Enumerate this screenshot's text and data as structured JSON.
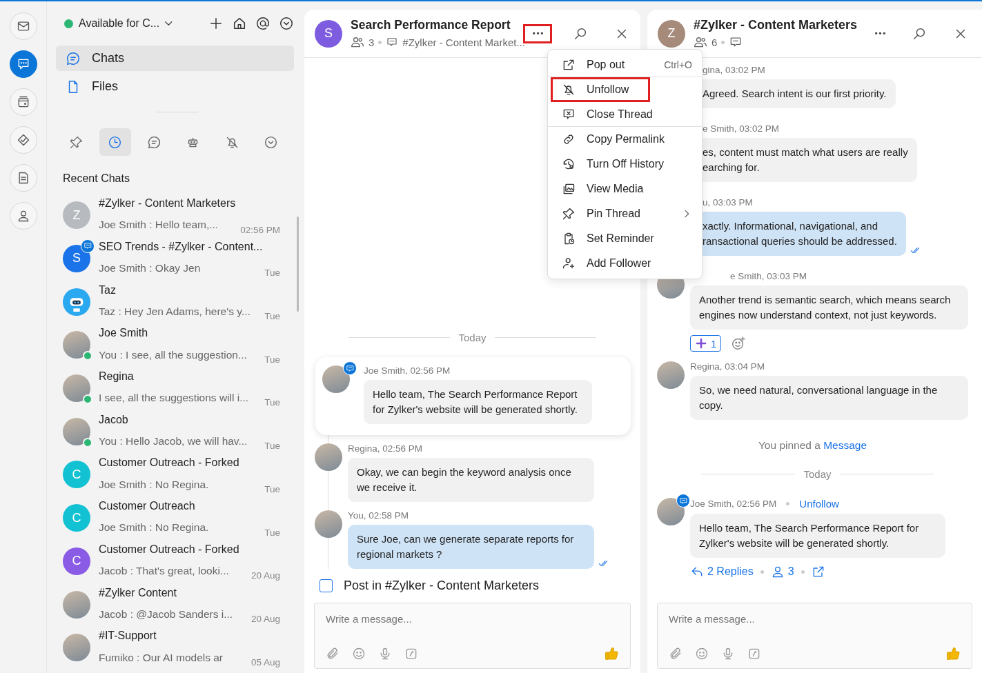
{
  "rail": [
    {
      "selected": false
    },
    {
      "selected": true
    },
    {
      "selected": false
    },
    {
      "selected": false
    },
    {
      "selected": false
    },
    {
      "selected": false
    }
  ],
  "sidebar": {
    "status": "Available for C...",
    "nav": [
      {
        "label": "Chats",
        "selected": true
      },
      {
        "label": "Files",
        "selected": false
      }
    ],
    "filters": [
      {
        "selected": false
      },
      {
        "selected": true
      },
      {
        "selected": false
      },
      {
        "selected": false
      },
      {
        "selected": false
      },
      {
        "selected": false
      }
    ],
    "section_title": "Recent Chats",
    "chats": [
      {
        "name": "#Zylker - Content Marketers",
        "preview": "Joe Smith : Hello team,...",
        "time": "02:56 PM",
        "avatar": {
          "kind": "letter",
          "letter": "Z",
          "color": "#b7bbbf"
        },
        "online": false,
        "thread": false
      },
      {
        "name": "SEO Trends - #Zylker - Content...",
        "preview": "Joe Smith : Okay Jen",
        "time": "Tue",
        "avatar": {
          "kind": "letter",
          "letter": "S",
          "color": "#1a73e8"
        },
        "online": false,
        "thread": true
      },
      {
        "name": "Taz",
        "preview": "Taz : Hey Jen Adams, here's y...",
        "time": "Tue",
        "avatar": {
          "kind": "bot"
        },
        "online": false,
        "thread": false
      },
      {
        "name": "Joe Smith",
        "preview": "You : I see, all the suggestion...",
        "time": "Tue",
        "avatar": {
          "kind": "photo"
        },
        "online": true,
        "thread": false
      },
      {
        "name": "Regina",
        "preview": "I see, all the suggestions will i...",
        "time": "Tue",
        "avatar": {
          "kind": "photo"
        },
        "online": true,
        "thread": false
      },
      {
        "name": "Jacob",
        "preview": "You : Hello Jacob, we will hav...",
        "time": "Tue",
        "avatar": {
          "kind": "photo"
        },
        "online": true,
        "thread": false
      },
      {
        "name": "Customer Outreach - Forked",
        "preview": "Joe Smith : No Regina.",
        "time": "Tue",
        "avatar": {
          "kind": "letter",
          "letter": "C",
          "color": "#12c2d3"
        },
        "online": false,
        "thread": false
      },
      {
        "name": "Customer Outreach",
        "preview": "Joe Smith : No Regina.",
        "time": "Tue",
        "avatar": {
          "kind": "letter",
          "letter": "C",
          "color": "#12c2d3"
        },
        "online": false,
        "thread": false
      },
      {
        "name": "Customer Outreach - Forked",
        "preview": "Jacob : That's great, looki...",
        "time": "20 Aug",
        "avatar": {
          "kind": "letter",
          "letter": "C",
          "color": "#8a5ce6"
        },
        "online": false,
        "thread": false
      },
      {
        "name": "#Zylker Content",
        "preview": "Jacob : @Jacob Sanders  i...",
        "time": "20 Aug",
        "avatar": {
          "kind": "photo"
        },
        "online": false,
        "thread": false
      },
      {
        "name": "#IT-Support",
        "preview": "Fumiko : Our AI models ar",
        "time": "05 Aug",
        "avatar": {
          "kind": "photo"
        },
        "online": false,
        "thread": false
      }
    ]
  },
  "thread": {
    "title": "Search Performance Report",
    "avatar": {
      "kind": "letter",
      "letter": "S",
      "color": "#7e5ce0"
    },
    "members": "3",
    "channel": "#Zylker - Content Market...",
    "more_highlighted": true,
    "menu": [
      {
        "label": "Pop out",
        "shortcut": "Ctrl+O",
        "highlighted": false,
        "submenu": false,
        "divider_after": true
      },
      {
        "label": "Unfollow",
        "highlighted": true,
        "submenu": false,
        "divider_after": false
      },
      {
        "label": "Close Thread",
        "highlighted": false,
        "submenu": false,
        "divider_after": true
      },
      {
        "label": "Copy Permalink",
        "highlighted": false,
        "submenu": false,
        "divider_after": false
      },
      {
        "label": "Turn Off History",
        "highlighted": false,
        "submenu": false,
        "divider_after": false
      },
      {
        "label": "View Media",
        "highlighted": false,
        "submenu": false,
        "divider_after": false
      },
      {
        "label": "Pin Thread",
        "highlighted": false,
        "submenu": true,
        "divider_after": false
      },
      {
        "label": "Set Reminder",
        "highlighted": false,
        "submenu": false,
        "divider_after": false
      },
      {
        "label": "Add Follower",
        "highlighted": false,
        "submenu": false,
        "divider_after": false
      }
    ],
    "date": "Today",
    "parent": {
      "header": "Joe Smith, 02:56 PM",
      "text": "Hello team, The Search Performance Report for Zylker's website will be generated shortly."
    },
    "replies": [
      {
        "header": "Regina, 02:56 PM",
        "text": "Okay, we can begin the keyword analysis once we receive it.",
        "sent": false,
        "read": false
      },
      {
        "header": "You, 02:58 PM",
        "text": "Sure Joe, can we generate separate reports for regional markets ?",
        "sent": true,
        "read": true
      }
    ],
    "post_in": {
      "label": "Post in #Zylker - Content Marketers",
      "checked": false
    },
    "composer": {
      "placeholder": "Write a message..."
    }
  },
  "channel": {
    "title": "#Zylker - Content Marketers",
    "avatar": {
      "kind": "letter",
      "letter": "Z",
      "color": "#a68b7b"
    },
    "members": "6",
    "messages": [
      {
        "kind": "clipped",
        "header": "gina, 03:02 PM",
        "text": "Agreed. Search intent is our first priority.",
        "sent": false,
        "read": false
      },
      {
        "kind": "clipped",
        "header": "e Smith, 03:02 PM",
        "text": "es, content must match what users are really\nearching for.",
        "sent": false,
        "read": false
      },
      {
        "kind": "clipped",
        "header": "u, 03:03 PM",
        "text": "xactly. Informational, navigational, and\nransactional queries should be addressed.",
        "sent": true,
        "read": true
      },
      {
        "kind": "partial",
        "header": "e Smith, 03:03 PM",
        "text": "Another trend is semantic search, which means search engines now understand context, not just keywords.",
        "sent": false,
        "read": false,
        "reactions": [
          {
            "count": "1",
            "selected": true
          }
        ]
      },
      {
        "kind": "message",
        "header": "Regina, 03:04 PM",
        "text": "So, we need natural, conversational language in the copy.",
        "sent": false,
        "read": false
      },
      {
        "kind": "notice",
        "text": "You pinned a",
        "link": "Message"
      },
      {
        "kind": "date",
        "text": "Today"
      },
      {
        "kind": "thread",
        "header": "Joe Smith, 02:56 PM",
        "action": "Unfollow",
        "text": "Hello team, The Search Performance Report for Zylker's website will be generated shortly.",
        "replies": "2 Replies",
        "participants": "3"
      }
    ],
    "composer": {
      "placeholder": "Write a message..."
    }
  }
}
